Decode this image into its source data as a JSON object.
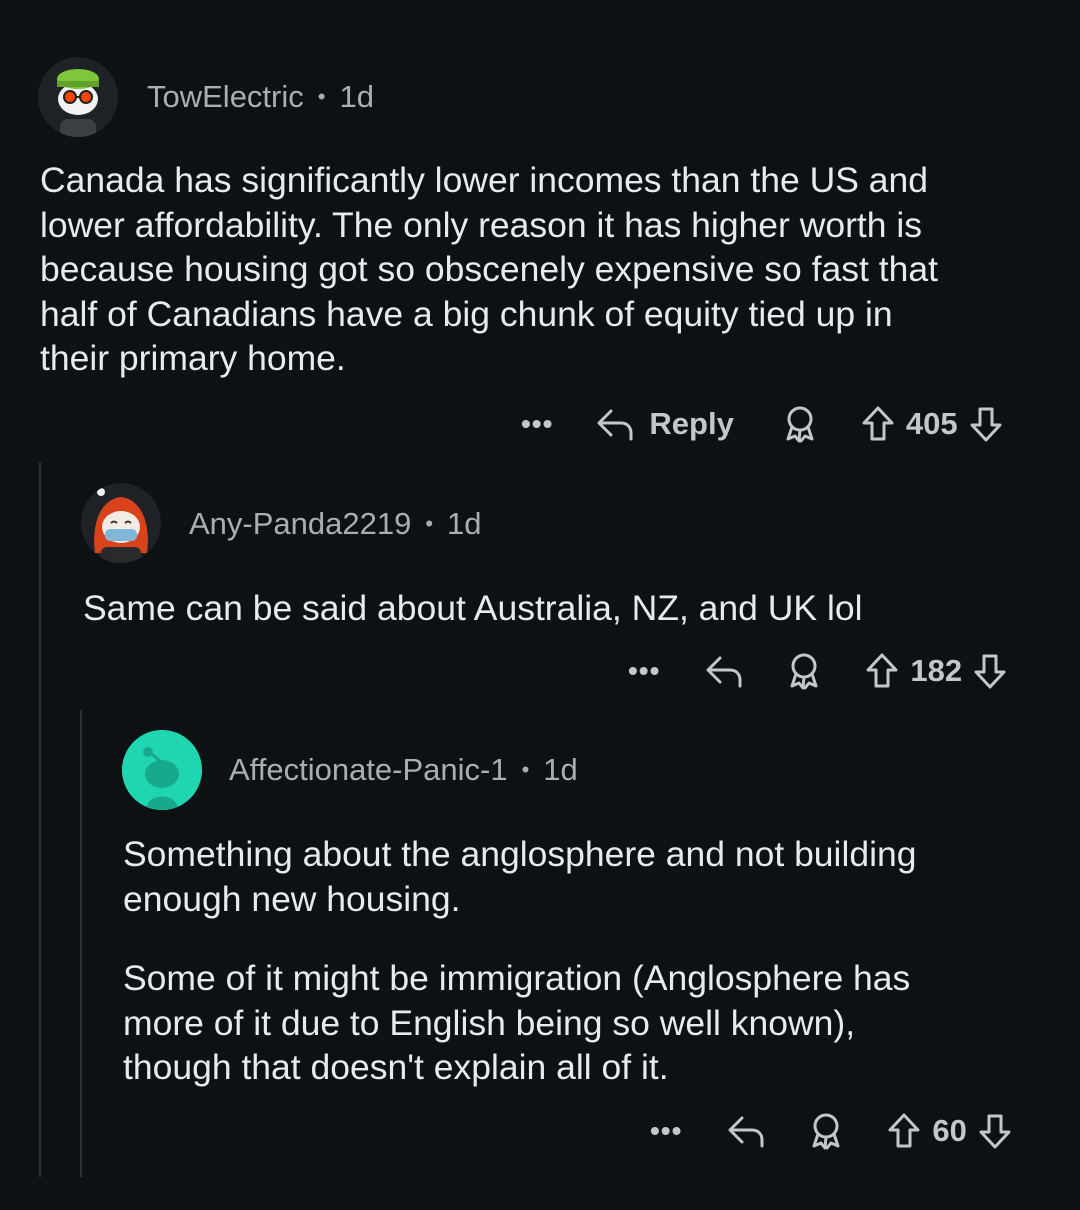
{
  "comments": [
    {
      "username": "TowElectric",
      "separator": "•",
      "age": "1d",
      "paragraphs": [
        "Canada has significantly lower incomes than the US and\nlower affordability.  The only reason it has higher worth is\nbecause housing got so obscenely expensive so fast that\nhalf of Canadians have a big chunk of equity tied up in\ntheir primary home."
      ],
      "more_label": "•••",
      "reply_label": "Reply",
      "score": "405"
    },
    {
      "username": "Any-Panda2219",
      "separator": "•",
      "age": "1d",
      "paragraphs": [
        "Same can be said about Australia, NZ, and UK lol"
      ],
      "more_label": "•••",
      "score": "182"
    },
    {
      "username": "Affectionate-Panic-1",
      "separator": "•",
      "age": "1d",
      "paragraphs": [
        "Something about the anglosphere and not building\nenough new housing.",
        "Some of it might be immigration (Anglosphere has\nmore of it due to English being so well known),\nthough that doesn't explain all of it."
      ],
      "more_label": "•••",
      "score": "60"
    }
  ],
  "colors": {
    "background": "#0e1113",
    "text": "#e8eaed",
    "meta": "#a8aeb4",
    "action": "#c2c7cc",
    "thread_line": "#2c3034",
    "avatar_teal": "#1fd6b1"
  }
}
